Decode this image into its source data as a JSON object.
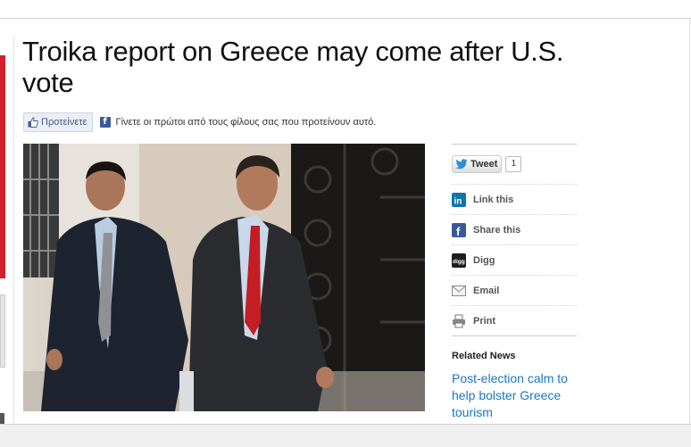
{
  "article": {
    "headline": "Troika report on Greece may come after U.S. vote"
  },
  "facebook": {
    "like_label": "Προτείνετε",
    "social_text": "Γίνετε οι πρώτοι από τους φίλους σας που προτείνουν αυτό."
  },
  "share": {
    "tweet_label": "Tweet",
    "tweet_count": "1",
    "items": [
      {
        "label": "Link this",
        "icon": "linkedin-icon",
        "color": "#0e76a8"
      },
      {
        "label": "Share this",
        "icon": "facebook-icon",
        "color": "#3b5998"
      },
      {
        "label": "Digg",
        "icon": "digg-icon",
        "color": "#1d1d1d"
      },
      {
        "label": "Email",
        "icon": "email-icon",
        "color": "#888888"
      },
      {
        "label": "Print",
        "icon": "printer-icon",
        "color": "#777777"
      }
    ]
  },
  "related": {
    "title": "Related News",
    "link": "Post-election calm to help bolster Greece tourism"
  },
  "colors": {
    "link": "#1a76c2",
    "accent_red": "#d0202a"
  }
}
